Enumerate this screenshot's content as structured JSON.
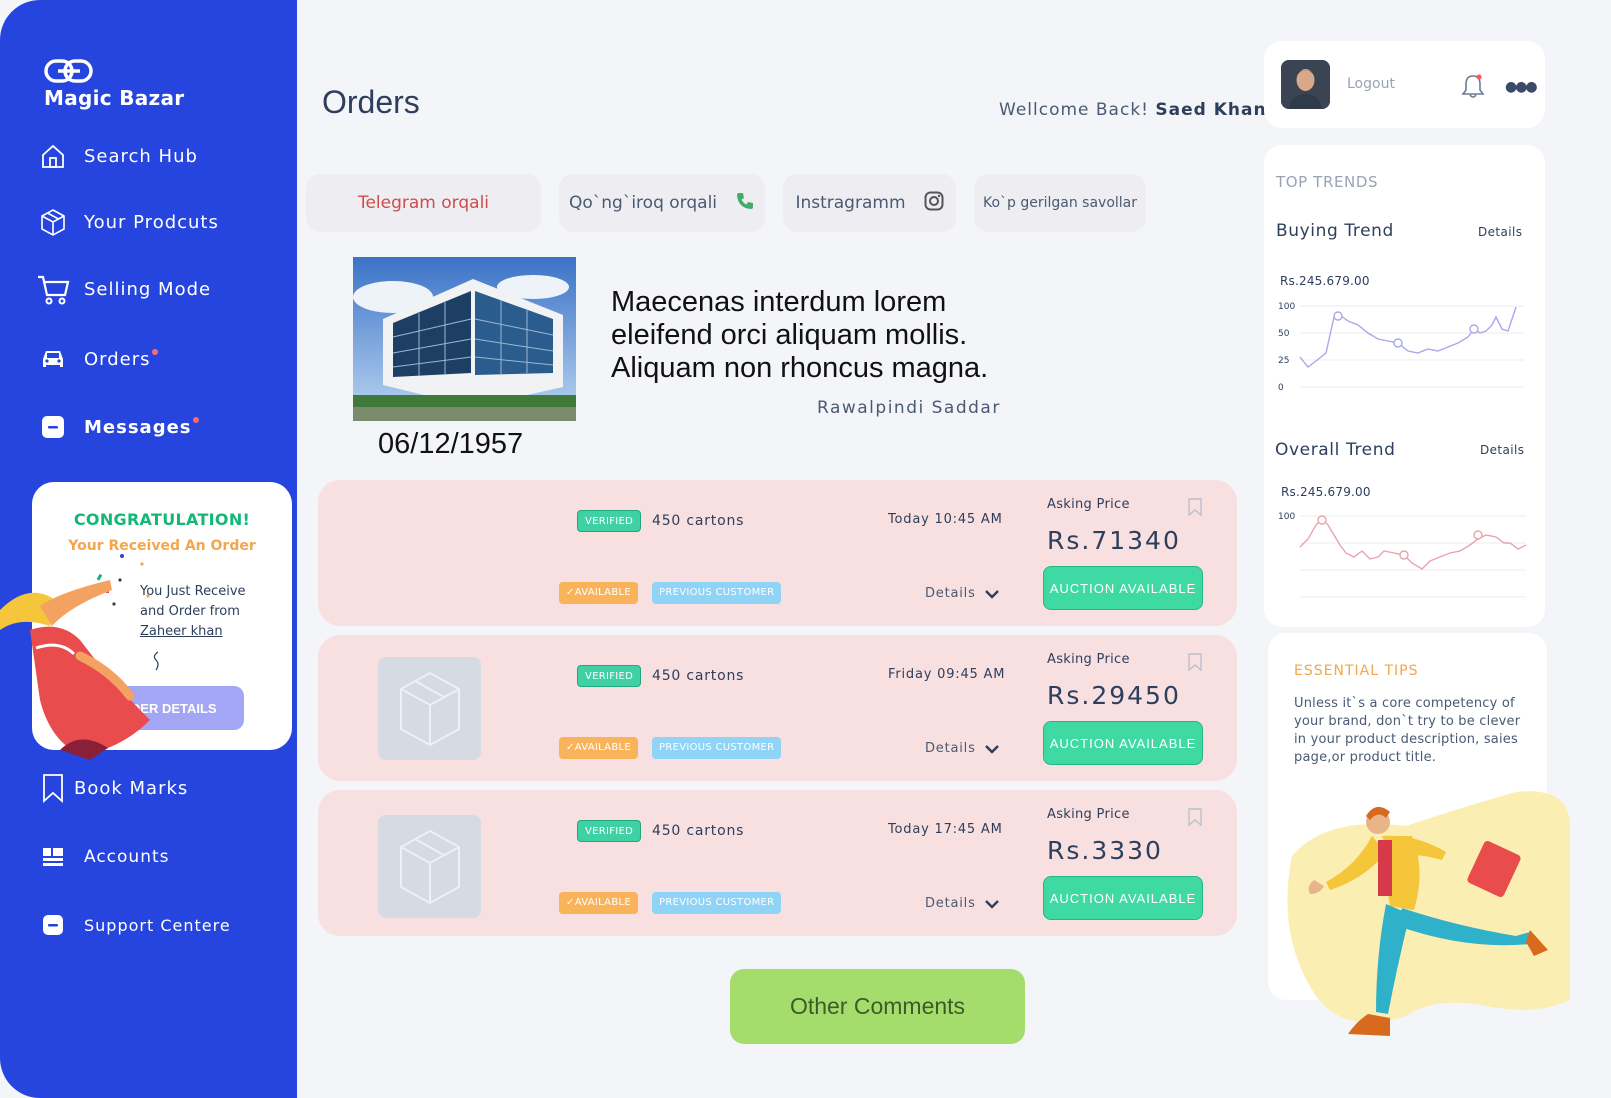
{
  "brand": {
    "name": "Magic Bazar"
  },
  "sidebar": {
    "items": [
      {
        "label": "Search Hub"
      },
      {
        "label": "Your Prodcuts"
      },
      {
        "label": "Selling Mode"
      },
      {
        "label": "Orders"
      },
      {
        "label": "Messages"
      },
      {
        "label": "Book Marks"
      },
      {
        "label": "Accounts"
      },
      {
        "label": "Support Centere"
      }
    ]
  },
  "congrats": {
    "title": "CONGRATULATION!",
    "subtitle": "Your Received An Order",
    "line1": "You Just Receive",
    "line2": "and Order from",
    "from": "Zaheer khan",
    "button": "ORDER DETAILS"
  },
  "header": {
    "title": "Orders",
    "welcome": "Wellcome Back!",
    "user": "Saed Khan"
  },
  "contacts": [
    {
      "label": "Telegram orqali"
    },
    {
      "label": "Qo`ng`iroq orqali"
    },
    {
      "label": "Instragramm"
    },
    {
      "label": "Ko`p gerilgan savollar"
    }
  ],
  "feature": {
    "text": "Maecenas interdum lorem eleifend orci aliquam mollis. Aliquam non rhoncus magna.",
    "location": "Rawalpindi Saddar",
    "date": "06/12/1957"
  },
  "orders": [
    {
      "verified": "VERIFIED",
      "quantity": "450 cartons",
      "time": "Today 10:45 AM",
      "asking_label": "Asking Price",
      "price": "Rs.71340",
      "available": "AVAILABLE",
      "previous": "PREVIOUS CUSTOMER",
      "details": "Details",
      "auction": "AUCTION AVAILABLE",
      "has_thumb": false
    },
    {
      "verified": "VERIFIED",
      "quantity": "450 cartons",
      "time": "Friday 09:45 AM",
      "asking_label": "Asking Price",
      "price": "Rs.29450",
      "available": "AVAILABLE",
      "previous": "PREVIOUS CUSTOMER",
      "details": "Details",
      "auction": "AUCTION AVAILABLE",
      "has_thumb": true
    },
    {
      "verified": "VERIFIED",
      "quantity": "450 cartons",
      "time": "Today 17:45 AM",
      "asking_label": "Asking Price",
      "price": "Rs.3330",
      "available": "AVAILABLE",
      "previous": "PREVIOUS CUSTOMER",
      "details": "Details",
      "auction": "AUCTION AVAILABLE",
      "has_thumb": true
    }
  ],
  "other_comments": "Other Comments",
  "profile": {
    "logout": "Logout"
  },
  "trends": {
    "header": "TOP TRENDS",
    "buying": {
      "title": "Buying Trend",
      "details": "Details",
      "value": "Rs.245.679.00",
      "ticks": [
        "100",
        "50",
        "25",
        "0"
      ]
    },
    "overall": {
      "title": "Overall Trend",
      "details": "Details",
      "value": "Rs.245.679.00",
      "ticks": [
        "100"
      ]
    }
  },
  "tips": {
    "header": "ESSENTIAL TIPS",
    "body": "Unless it`s a core competency of your brand, don`t try to be clever in your product description, saies page,or product title."
  },
  "colors": {
    "sidebar": "#2645de",
    "order_card": "#f8dfe0",
    "auction": "#3fd9a4",
    "other_comments": "#a4dd6b",
    "accent_orange": "#f3a64b"
  }
}
